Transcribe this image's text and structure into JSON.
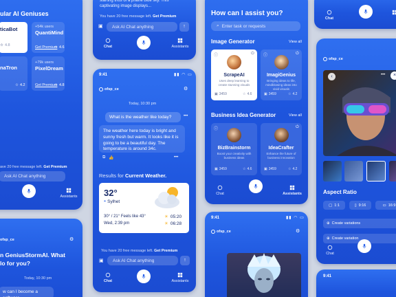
{
  "brand": "ofsp_ce",
  "p1": {
    "heading": "ular AI Geniuses",
    "cards": [
      {
        "name": "ticaBot",
        "users": "",
        "rating": "4.8",
        "cta": ""
      },
      {
        "name": "QuantiMind",
        "users": "+54k users",
        "rating": "4.6",
        "cta": "Get Premium"
      },
      {
        "name": "naTron",
        "users": "",
        "rating": "4.2",
        "cta": "Get Premium"
      },
      {
        "name": "PixelDream",
        "users": "+79k users",
        "rating": "4.8",
        "cta": "Get Premium"
      }
    ],
    "free_msg": "ave 20 free message left.",
    "free_cta": "Get Premium",
    "input_placeholder": "Ask AI Chat anything",
    "nav_assistants": "Assistants"
  },
  "p2": {
    "top_text": "starting thus of a prairie blue sky. This captivating image displays...",
    "free_msg": "You have 20 free message left.",
    "free_cta": "Get Premium",
    "input_placeholder": "Ask AI Chat anything",
    "nav_chat": "Chat",
    "nav_assistants": "Assistants"
  },
  "p3": {
    "heading": "How can I assist you?",
    "search_placeholder": "Enter task or requests",
    "section1": "Image Generator",
    "view_all": "View all",
    "image_cards": [
      {
        "name": "ScrapeAI",
        "desc": "Uses deep learning to create stunning visuals",
        "count": "3459",
        "rating": "4.6"
      },
      {
        "name": "ImagiGenius",
        "desc": "Bringing ideas to life, mindblowing ideas into vivid visuals",
        "count": "3459",
        "rating": "4.2"
      }
    ],
    "section2": "Business Idea Generator",
    "biz_cards": [
      {
        "name": "BizBrainstorm",
        "desc": "Boost your creativity with business ideas",
        "count": "3459",
        "rating": "4.6"
      },
      {
        "name": "IdeaCrafter",
        "desc": "Enhance the future of business innovation",
        "count": "3459",
        "rating": "4.2"
      }
    ],
    "nav_chat": "Chat",
    "nav_assistants": "Assistants"
  },
  "p4": {
    "nav_chat": "Chat"
  },
  "p5": {
    "time": "9:41",
    "date": "Today, 10:30 pm",
    "user_msg": "What is the weather like today?",
    "ai_msg": "The weather here today is bright and sunny fresh but warm. It looks like it is going to be a beautiful day. The temperature is around 34c.",
    "results_prefix": "Results for ",
    "results_bold": "Current Weather.",
    "weather": {
      "temp": "32°",
      "location": "Sylhet",
      "detail": "30° / 21° Feels like 43°",
      "datetime": "Wed, 2:39 pm",
      "sunrise": "05:20",
      "sunset": "06:28"
    },
    "free_msg": "You have 20 free message left.",
    "free_cta": "Get Premium",
    "input_placeholder": "Ask AI Chat anything",
    "nav_chat": "Chat",
    "nav_assistants": "Assistants"
  },
  "p6": {
    "section": "Aspect Ratio",
    "ratios": [
      "1:1",
      "9:16",
      "16:9"
    ],
    "create1": "Create variations",
    "create2": "Create variation",
    "nav_chat": "Chat"
  },
  "p7": {
    "title_line1": "n GeniusStormAI. What",
    "title_line2": "lo for you?",
    "date": "Today, 10:30 pm",
    "msg": "w can I become a software"
  },
  "p8": {
    "time": "9:41"
  },
  "p9": {
    "time": "9:41"
  },
  "colors": {
    "accent": "#2b63ea",
    "brand_text": "#ffffff",
    "premium": "#ffffff",
    "star": "#f5b400"
  }
}
